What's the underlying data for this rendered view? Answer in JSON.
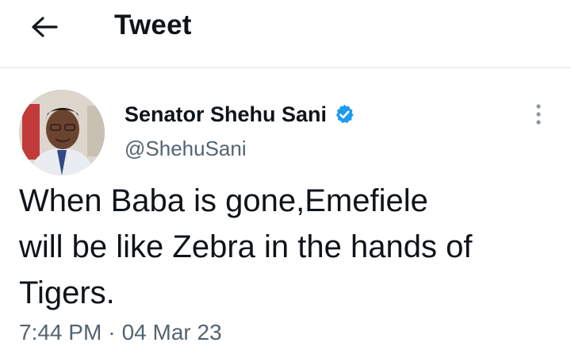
{
  "header": {
    "title": "Tweet",
    "back_icon": "arrow-left-icon"
  },
  "author": {
    "name": "Senator Shehu Sani",
    "handle": "@ShehuSani",
    "verified": true,
    "verified_color": "#1d9bf0",
    "avatar_icon": "user-avatar"
  },
  "tweet": {
    "text": "When Baba is gone,Emefiele\nwill be like Zebra in the hands of\nTigers.",
    "time": "7:44 PM",
    "separator": "·",
    "date": "04 Mar 23"
  },
  "more_icon": "more-vertical-icon"
}
